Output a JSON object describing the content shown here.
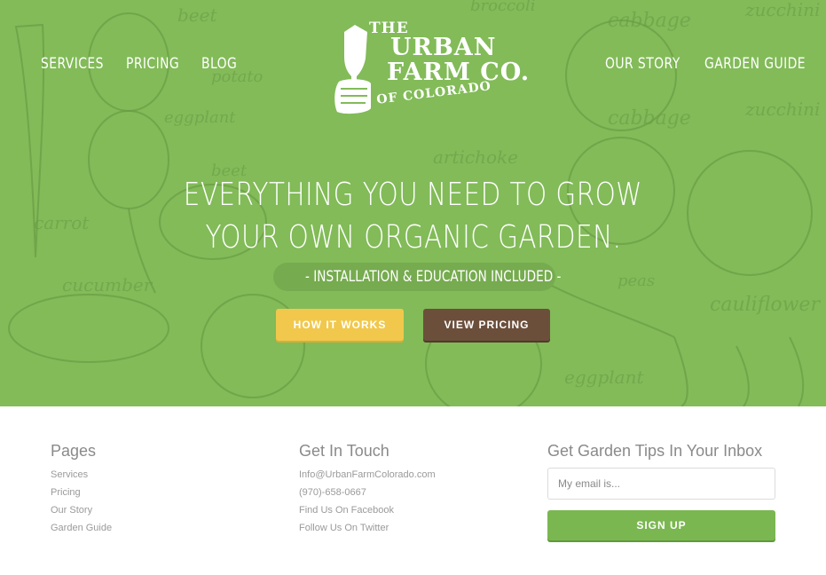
{
  "nav": {
    "left": [
      "SERVICES",
      "PRICING",
      "BLOG"
    ],
    "right": [
      "OUR STORY",
      "GARDEN GUIDE"
    ]
  },
  "logo": {
    "line1": "THE",
    "line2": "URBAN",
    "line3": "FARM CO.",
    "line4": "OF COLORADO"
  },
  "hero": {
    "headline_line1": "EVERYTHING YOU NEED TO GROW",
    "headline_line2": "YOUR OWN ORGANIC GARDEN.",
    "subline": "- INSTALLATION & EDUCATION INCLUDED -",
    "primary_button": "HOW IT WORKS",
    "secondary_button": "VIEW PRICING",
    "background_words": [
      "beet",
      "broccoli",
      "cabbage",
      "zucchini",
      "potato",
      "artichoke",
      "carrot",
      "cucumber",
      "peas",
      "cauliflower",
      "eggplant",
      "beet",
      "potato",
      "cabbage",
      "zucchini"
    ]
  },
  "footer": {
    "pages": {
      "title": "Pages",
      "links": [
        "Services",
        "Pricing",
        "Our Story",
        "Garden Guide"
      ]
    },
    "contact": {
      "title": "Get In Touch",
      "links": [
        "Info@UrbanFarmColorado.com",
        "(970)-658-0667",
        "Find Us On Facebook",
        "Follow Us On Twitter"
      ]
    },
    "newsletter": {
      "title": "Get Garden Tips In Your Inbox",
      "placeholder": "My email is...",
      "button": "SIGN UP"
    }
  },
  "colors": {
    "hero_green": "#82bb58",
    "button_yellow": "#f1c84c",
    "button_brown": "#6b4f3b",
    "signup_green": "#7ab750"
  }
}
